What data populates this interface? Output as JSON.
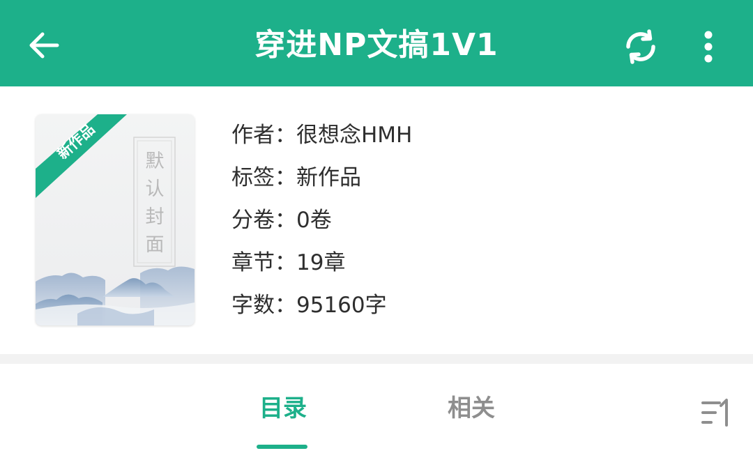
{
  "header": {
    "title": "穿进NP文搞1V1",
    "background_color": "#1db08a",
    "back_icon": "arrow-left-icon",
    "refresh_icon": "refresh-icon",
    "more_icon": "more-vertical-icon"
  },
  "book": {
    "cover": {
      "badge": "新作品",
      "placeholder_text": "默认封面",
      "badge_color": "#1db08a"
    },
    "meta": [
      {
        "label": "作者：",
        "value": "很想念HMH"
      },
      {
        "label": "标签：",
        "value": "新作品"
      },
      {
        "label": "分卷：",
        "value": "0卷"
      },
      {
        "label": "章节：",
        "value": "19章"
      },
      {
        "label": "字数：",
        "value": "95160字"
      }
    ]
  },
  "tabs": {
    "items": [
      {
        "label": "目录",
        "active": true
      },
      {
        "label": "相关",
        "active": false
      }
    ],
    "active_color": "#1db08a",
    "inactive_color": "#8e8e8e",
    "sort_icon": "sort-icon"
  }
}
